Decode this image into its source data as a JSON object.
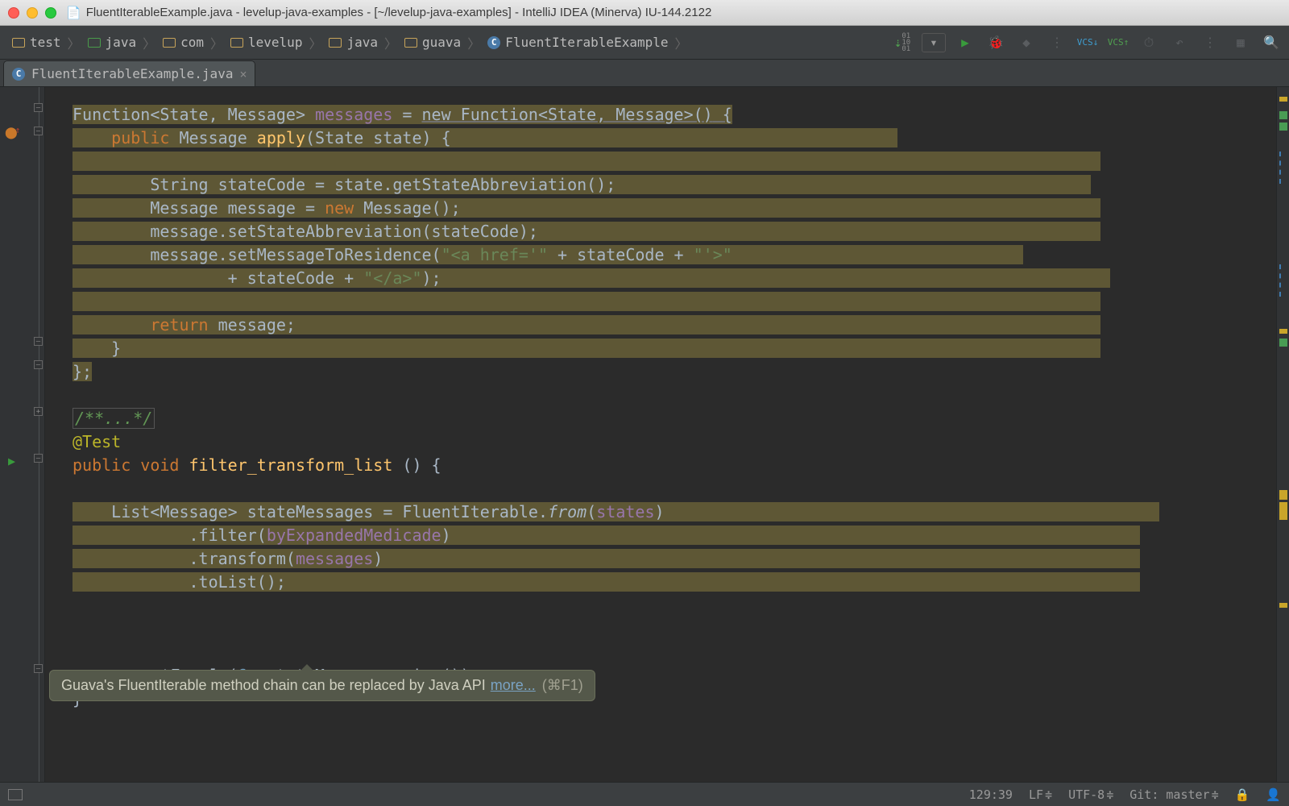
{
  "window": {
    "title": "FluentIterableExample.java - levelup-java-examples - [~/levelup-java-examples] - IntelliJ IDEA (Minerva) IU-144.2122"
  },
  "breadcrumbs": [
    {
      "label": "test",
      "type": "folder"
    },
    {
      "label": "java",
      "type": "src"
    },
    {
      "label": "com",
      "type": "folder"
    },
    {
      "label": "levelup",
      "type": "folder"
    },
    {
      "label": "java",
      "type": "folder"
    },
    {
      "label": "guava",
      "type": "folder"
    },
    {
      "label": "FluentIterableExample",
      "type": "class"
    }
  ],
  "tab": {
    "label": "FluentIterableExample.java"
  },
  "code": {
    "l1": "Function<State, Message> ",
    "l1b": "messages",
    "l1c": " = ",
    "l1d": "new Function<State, Message>()",
    "l1e": " {",
    "l2a": "public",
    "l2b": " Message ",
    "l2c": "apply",
    "l2d": "(State state) {",
    "l4a": "String stateCode = state.getStateAbbreviation();",
    "l5a": "Message message = ",
    "l5b": "new",
    "l5c": " Message();",
    "l6a": "message.setStateAbbreviation(stateCode);",
    "l7a": "message.setMessageToResidence(",
    "l7b": "\"<a href='\"",
    "l7c": " + stateCode + ",
    "l7d": "\"'>\"",
    "l8a": "+ stateCode + ",
    "l8b": "\"</a>\"",
    "l8c": ");",
    "l10a": "return",
    "l10b": " message;",
    "l11a": "}",
    "l12a": "};",
    "cmt": "/**...*/",
    "anno": "@Test",
    "m1a": "public",
    "m1b": " ",
    "m1c": "void",
    "m1d": " ",
    "m1e": "filter_transform_list",
    "m1f": " () {",
    "f1a": "List<Message> stateMessages = FluentIterable.",
    "f1b": "from",
    "f1c": "(",
    "f1d": "states",
    "f1e": ")",
    "f2a": ".filter(",
    "f2b": "byExpandedMedicade",
    "f2c": ")",
    "f3a": ".transform(",
    "f3b": "messages",
    "f3c": ")",
    "f4a": ".toList();",
    "asa": "assertEquals",
    "asb": "(",
    "asc": "6",
    "asd": ", stateMessages.size());",
    "cb": "}"
  },
  "tooltip": {
    "text": "Guava's FluentIterable method chain can be replaced by Java API",
    "link": "more...",
    "shortcut": "(⌘F1)"
  },
  "status": {
    "pos": "129:39",
    "lf": "LF",
    "enc": "UTF-8",
    "git": "Git: master"
  },
  "toolbar": {
    "vcs_update": "VCS",
    "vcs_commit": "VCS"
  }
}
